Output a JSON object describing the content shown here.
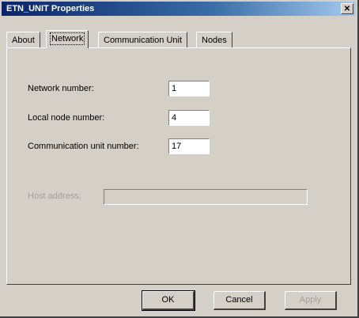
{
  "window": {
    "title": "ETN_UNIT Properties",
    "close_glyph": "✕"
  },
  "tabs": [
    {
      "label": "About",
      "active": false
    },
    {
      "label": "Network",
      "active": true
    },
    {
      "label": "Communication Unit",
      "active": false
    },
    {
      "label": "Nodes",
      "active": false
    }
  ],
  "form": {
    "network_number": {
      "label": "Network number:",
      "value": "1"
    },
    "local_node_number": {
      "label": "Local node number:",
      "value": "4"
    },
    "communication_unit_number": {
      "label": "Communication unit number:",
      "value": "17"
    },
    "disabled_field": {
      "label": "Host address:",
      "value": ""
    }
  },
  "buttons": {
    "ok": "OK",
    "cancel": "Cancel",
    "apply": "Apply"
  },
  "colors": {
    "titlebar_start": "#0a246a",
    "face": "#d4d0c8"
  }
}
